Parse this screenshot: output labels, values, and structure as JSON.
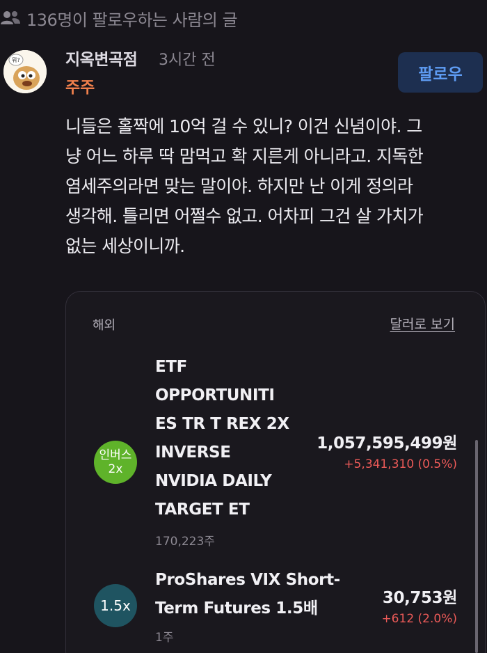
{
  "header": {
    "followers_text": "136명이 팔로우하는 사람의 글",
    "icon": "people-icon"
  },
  "author": {
    "name": "지옥변곡점",
    "time": "3시간 전",
    "subtitle": "주주",
    "avatar_icon": "avatar-character-icon",
    "avatar_bubble": "뭐?",
    "follow_label": "팔로우"
  },
  "post": {
    "lines": [
      "니들은 홀짝에 10억 걸 수 있니? 이건 신념이야.  그",
      "냥 어느 하루 딱 맘먹고 확 지른게 아니라고. 지독한",
      "염세주의라면 맞는 말이야.  하지만 난 이게 정의라",
      "생각해. 틀리면 어쩔수 없고. 어차피 그건 살 가치가",
      "없는 세상이니까."
    ]
  },
  "card": {
    "region": "해외",
    "currency_link": "달러로 보기",
    "holdings": [
      {
        "badge_line1": "인버스",
        "badge_line2": "2x",
        "name_lines": [
          "ETF",
          "OPPORTUNITI",
          "ES TR T REX 2X",
          "INVERSE",
          "NVIDIA DAILY",
          "TARGET ET"
        ],
        "quantity": "170,223주",
        "value": "1,057,595,499원",
        "change": "+5,341,310 (0.5%)"
      },
      {
        "badge_line1": "1.5x",
        "badge_line2": "",
        "name_lines": [
          "ProShares VIX Short-",
          "Term Futures 1.5배"
        ],
        "quantity": "1주",
        "value": "30,753원",
        "change": "+612 (2.0%)"
      }
    ]
  },
  "colors": {
    "background": "#17151b",
    "accent_orange": "#f0804c",
    "follow_blue": "#5e9cf3",
    "gain_red": "#ec5a58",
    "badge_green": "#5fb32a",
    "badge_teal": "#1f5461"
  }
}
